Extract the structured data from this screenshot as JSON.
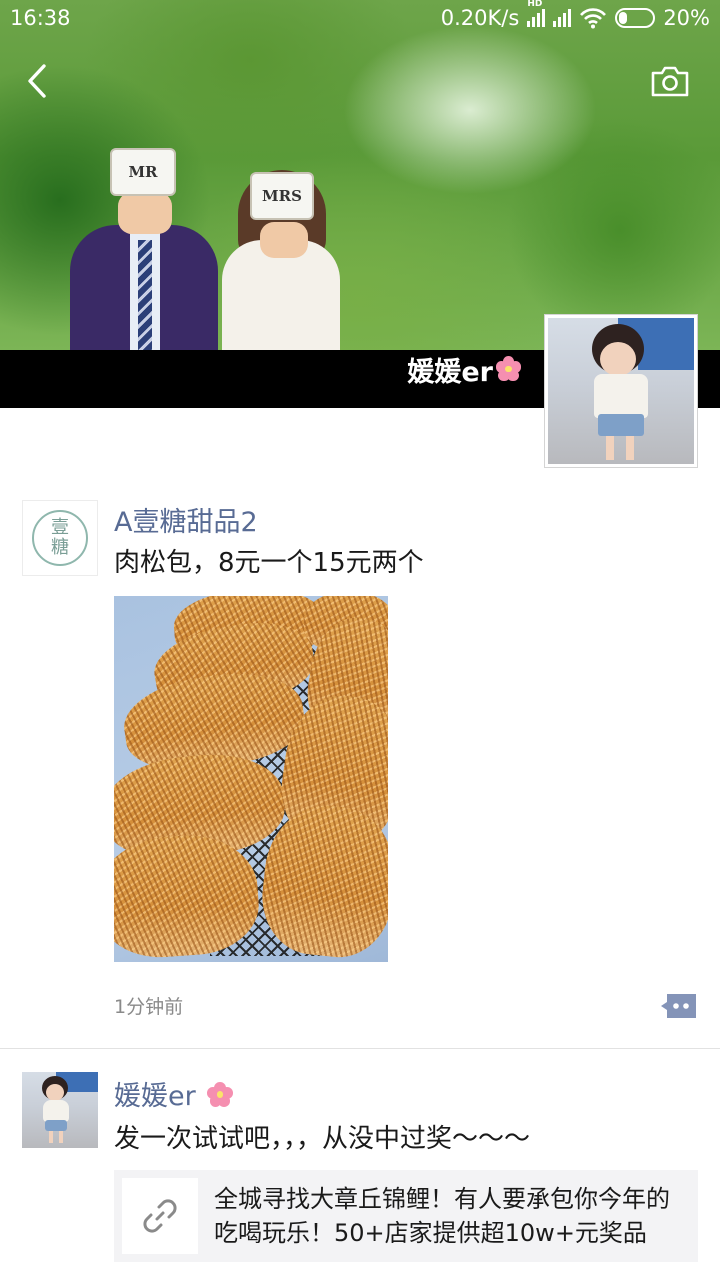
{
  "status_bar": {
    "time": "16:38",
    "net_speed": "0.20K/s",
    "net_badge": "HD",
    "battery": "20%"
  },
  "cover": {
    "username": "媛媛er",
    "sign_left": "MR",
    "sign_right": "MRS",
    "cover_bar_color": "#000000"
  },
  "icons": {
    "back": "back-chevron-icon",
    "camera": "camera-icon",
    "comment": "comment-dots-icon",
    "link": "link-icon",
    "flower": "cherry-blossom-emoji"
  },
  "posts": [
    {
      "author": "A壹糖甜品2",
      "avatar_text_top": "壹",
      "avatar_text_bottom": "糖",
      "text": "肉松包，8元一个15元两个",
      "time": "1分钟前"
    },
    {
      "author": "媛媛er",
      "text": "发一次试试吧，，，从没中过奖～～～",
      "link_title": "全城寻找大章丘锦鲤！有人要承包你今年的吃喝玩乐！50+店家提供超10w+元奖品"
    }
  ],
  "colors": {
    "name_link": "#586b94",
    "timestamp": "#8a8a8a",
    "link_card_bg": "#f3f3f5",
    "blossom": "#f58fb0"
  }
}
